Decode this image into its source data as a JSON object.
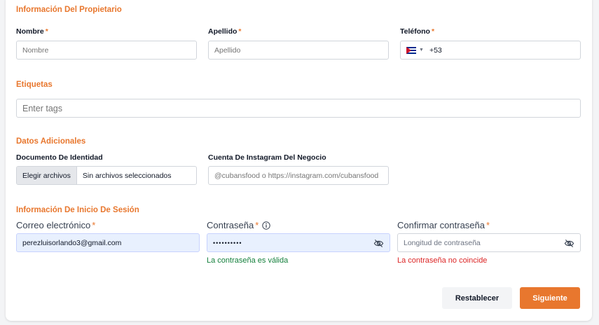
{
  "owner": {
    "section_title": "Información Del Propietario",
    "first_name": {
      "label": "Nombre",
      "required": "*",
      "placeholder": "Nombre"
    },
    "last_name": {
      "label": "Apellido",
      "required": "*",
      "placeholder": "Apellido"
    },
    "phone": {
      "label": "Teléfono",
      "required": "*",
      "dial_code": "+53",
      "flag_icon": "cuba-flag-icon",
      "dropdown_icon": "caret-down-icon"
    }
  },
  "tags": {
    "section_title": "Etiquetas",
    "placeholder": "Enter tags"
  },
  "additional": {
    "section_title": "Datos Adicionales",
    "id_document": {
      "label": "Documento De Identidad",
      "button": "Elegir archivos",
      "status": "Sin archivos seleccionados"
    },
    "instagram": {
      "label": "Cuenta De Instagram Del Negocio",
      "placeholder": "@cubansfood o https://instagram.com/cubansfood"
    }
  },
  "login": {
    "section_title": "Información De Inicio De Sesión",
    "email": {
      "label": "Correo electrónico",
      "required": "*",
      "value": "perezluisorlando3@gmail.com"
    },
    "password": {
      "label": "Contraseña",
      "required": "*",
      "value": "••••••••••",
      "info_icon": "info-icon",
      "toggle_icon": "eye-off-icon",
      "message": "La contraseña es válida"
    },
    "confirm": {
      "label": "Confirmar contraseña",
      "required": "*",
      "placeholder": "Longitud de contraseña",
      "toggle_icon": "eye-off-icon",
      "message": "La contraseña no coincide"
    }
  },
  "actions": {
    "reset": "Restablecer",
    "next": "Siguiente"
  },
  "colors": {
    "accent": "#e8772e",
    "success": "#15803d",
    "error": "#dc2626",
    "autofill_bg": "#e8f0fe"
  }
}
